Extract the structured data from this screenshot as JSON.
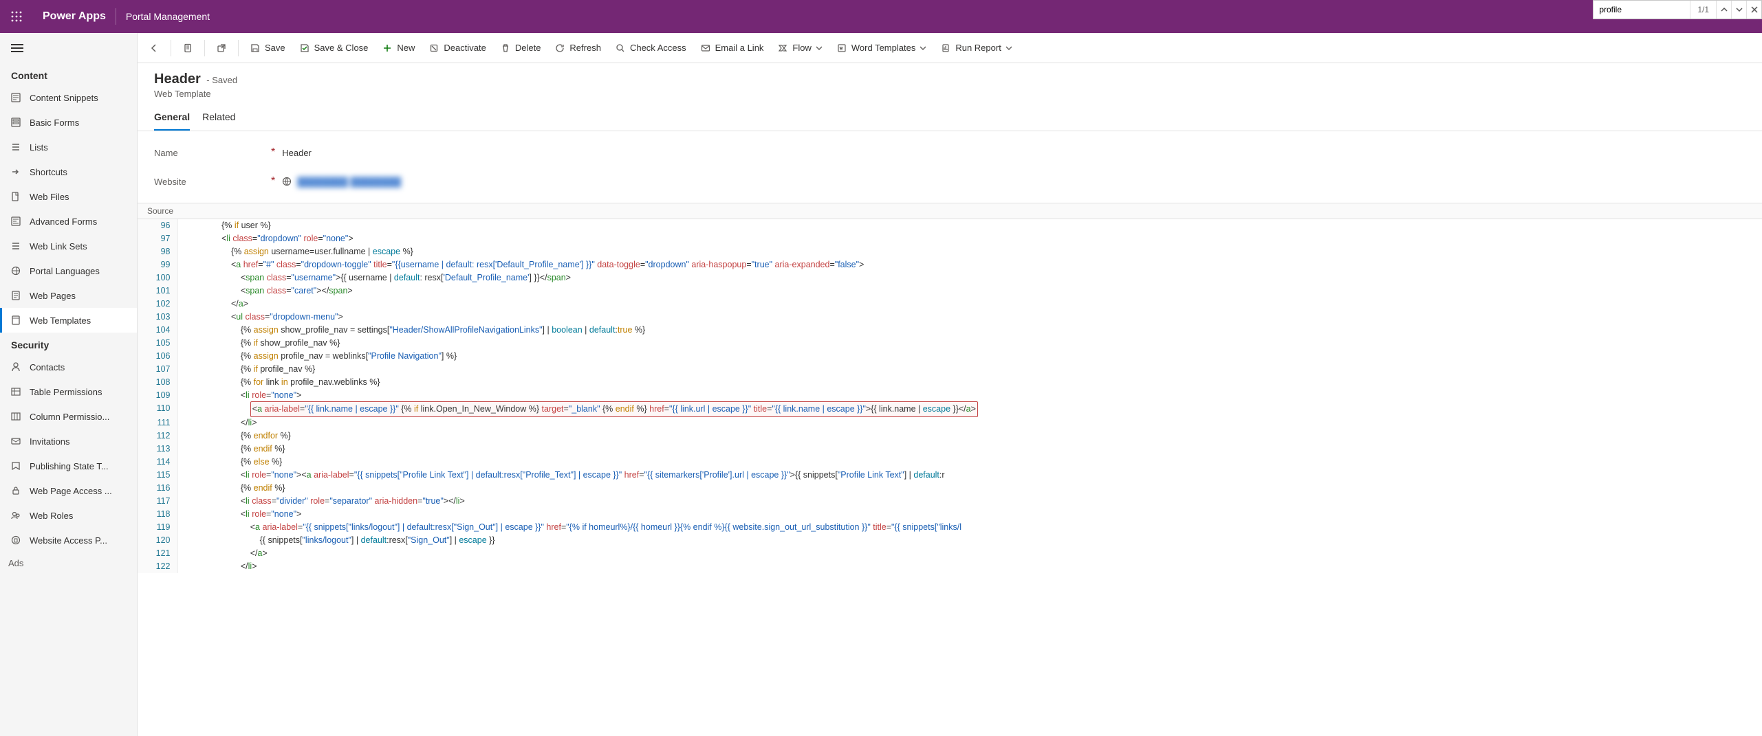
{
  "top": {
    "app": "Power Apps",
    "area": "Portal Management"
  },
  "find": {
    "value": "profile",
    "count": "1/1"
  },
  "side": {
    "g1": "Content",
    "items1": [
      {
        "id": "content-snippets",
        "label": "Content Snippets"
      },
      {
        "id": "basic-forms",
        "label": "Basic Forms"
      },
      {
        "id": "lists",
        "label": "Lists"
      },
      {
        "id": "shortcuts",
        "label": "Shortcuts"
      },
      {
        "id": "web-files",
        "label": "Web Files"
      },
      {
        "id": "advanced-forms",
        "label": "Advanced Forms"
      },
      {
        "id": "web-link-sets",
        "label": "Web Link Sets"
      },
      {
        "id": "portal-languages",
        "label": "Portal Languages"
      },
      {
        "id": "web-pages",
        "label": "Web Pages"
      },
      {
        "id": "web-templates",
        "label": "Web Templates"
      }
    ],
    "g2": "Security",
    "items2": [
      {
        "id": "contacts",
        "label": "Contacts"
      },
      {
        "id": "table-permissions",
        "label": "Table Permissions"
      },
      {
        "id": "column-permissio",
        "label": "Column Permissio..."
      },
      {
        "id": "invitations",
        "label": "Invitations"
      },
      {
        "id": "publishing-state",
        "label": "Publishing State T..."
      },
      {
        "id": "web-page-access",
        "label": "Web Page Access ..."
      },
      {
        "id": "web-roles",
        "label": "Web Roles"
      },
      {
        "id": "website-access",
        "label": "Website Access P..."
      }
    ],
    "ads": "Ads"
  },
  "cmd": {
    "save": "Save",
    "saveclose": "Save & Close",
    "new": "New",
    "deactivate": "Deactivate",
    "delete": "Delete",
    "refresh": "Refresh",
    "check": "Check Access",
    "email": "Email a Link",
    "flow": "Flow",
    "word": "Word Templates",
    "run": "Run Report"
  },
  "hdr": {
    "title": "Header",
    "status": "- Saved",
    "subtitle": "Web Template"
  },
  "tabs": {
    "general": "General",
    "related": "Related"
  },
  "form": {
    "name_label": "Name",
    "name_value": "Header",
    "site_label": "Website",
    "site_value": "████████  ████████"
  },
  "srcbar": "Source",
  "code_start": 96,
  "code": [
    {
      "i": 8,
      "h": "{% <kw>if</kw> user %}"
    },
    {
      "i": 8,
      "h": "&lt;<tag>li</tag> <attr>class</attr>=<str>\"dropdown\"</str> <attr>role</attr>=<str>\"none\"</str>&gt;"
    },
    {
      "i": 10,
      "h": "{% <kw>assign</kw> username=user.fullname | <fn>escape</fn> %}"
    },
    {
      "i": 10,
      "h": "&lt;<tag>a</tag> <attr>href</attr>=<str>\"#\"</str> <attr>class</attr>=<str>\"dropdown-toggle\"</str> <attr>title</attr>=<str>\"{{username | default: resx['Default_Profile_name'] }}\"</str> <attr>data-toggle</attr>=<str>\"dropdown\"</str> <attr>aria-haspopup</attr>=<str>\"true\"</str> <attr>aria-expanded</attr>=<str>\"false\"</str>&gt;"
    },
    {
      "i": 12,
      "h": "&lt;<tag>span</tag> <attr>class</attr>=<str>\"username\"</str>&gt;{{ username | <fn>default</fn>: resx[<str>'Default_Profile_name'</str>] }}&lt;/<tag>span</tag>&gt;"
    },
    {
      "i": 12,
      "h": "&lt;<tag>span</tag> <attr>class</attr>=<str>\"caret\"</str>&gt;&lt;/<tag>span</tag>&gt;"
    },
    {
      "i": 10,
      "h": "&lt;/<tag>a</tag>&gt;"
    },
    {
      "i": 10,
      "h": "&lt;<tag>ul</tag> <attr>class</attr>=<str>\"dropdown-menu\"</str>&gt;"
    },
    {
      "i": 12,
      "h": "{% <kw>assign</kw> show_profile_nav = settings[<str>\"Header/ShowAllProfileNavigationLinks\"</str>] | <fn>boolean</fn> | <fn>default</fn>:<kw>true</kw> %}"
    },
    {
      "i": 12,
      "h": "{% <kw>if</kw> show_profile_nav %}"
    },
    {
      "i": 12,
      "h": "{% <kw>assign</kw> profile_nav = weblinks[<str>\"Profile Navigation\"</str>] %}"
    },
    {
      "i": 12,
      "h": "{% <kw>if</kw> profile_nav %}"
    },
    {
      "i": 12,
      "h": "{% <kw>for</kw> link <kw>in</kw> profile_nav.weblinks %}"
    },
    {
      "i": 12,
      "h": "&lt;<tag>li</tag> <attr>role</attr>=<str>\"none\"</str>&gt;"
    },
    {
      "i": 14,
      "hl": true,
      "h": "&lt;<tag>a</tag> <attr>aria-label</attr>=<str>\"{{ link.name | escape }}\"</str> {% <kw>if</kw> link.Open_In_New_Window %} <attr>target</attr>=<str>\"_blank\"</str> {% <kw>endif</kw> %} <attr>href</attr>=<str>\"{{ link.url | escape }}\"</str> <attr>title</attr>=<str>\"{{ link.name | escape }}\"</str>&gt;{{ link.name | <fn>escape</fn> }}&lt;/<tag>a</tag>&gt;"
    },
    {
      "i": 12,
      "h": "&lt;/<tag>li</tag>&gt;"
    },
    {
      "i": 12,
      "h": "{% <kw>endfor</kw> %}"
    },
    {
      "i": 12,
      "h": "{% <kw>endif</kw> %}"
    },
    {
      "i": 12,
      "h": "{% <kw>else</kw> %}"
    },
    {
      "i": 12,
      "h": "&lt;<tag>li</tag> <attr>role</attr>=<str>\"none\"</str>&gt;&lt;<tag>a</tag> <attr>aria-label</attr>=<str>\"{{ snippets[&quot;Profile Link Text&quot;] | default:resx[&quot;Profile_Text&quot;] | escape }}\"</str> <attr>href</attr>=<str>\"{{ sitemarkers['Profile'].url | escape }}\"</str>&gt;{{ snippets[<str>\"Profile Link Text\"</str>] | <fn>default</fn>:r"
    },
    {
      "i": 12,
      "h": "{% <kw>endif</kw> %}"
    },
    {
      "i": 12,
      "h": "&lt;<tag>li</tag> <attr>class</attr>=<str>\"divider\"</str> <attr>role</attr>=<str>\"separator\"</str> <attr>aria-hidden</attr>=<str>\"true\"</str>&gt;&lt;/<tag>li</tag>&gt;"
    },
    {
      "i": 12,
      "h": "&lt;<tag>li</tag> <attr>role</attr>=<str>\"none\"</str>&gt;"
    },
    {
      "i": 14,
      "h": "&lt;<tag>a</tag> <attr>aria-label</attr>=<str>\"{{ snippets[&quot;links/logout&quot;] | default:resx[&quot;Sign_Out&quot;] | escape }}\"</str> <attr>href</attr>=<str>\"{% if homeurl%}/{{ homeurl }}{% endif %}{{ website.sign_out_url_substitution }}\"</str> <attr>title</attr>=<str>\"{{ snippets[&quot;links/l"
    },
    {
      "i": 16,
      "h": "{{ snippets[<str>\"links/logout\"</str>] | <fn>default</fn>:resx[<str>\"Sign_Out\"</str>] | <fn>escape</fn> }}"
    },
    {
      "i": 14,
      "h": "&lt;/<tag>a</tag>&gt;"
    },
    {
      "i": 12,
      "h": "&lt;/<tag>li</tag>&gt;"
    }
  ]
}
